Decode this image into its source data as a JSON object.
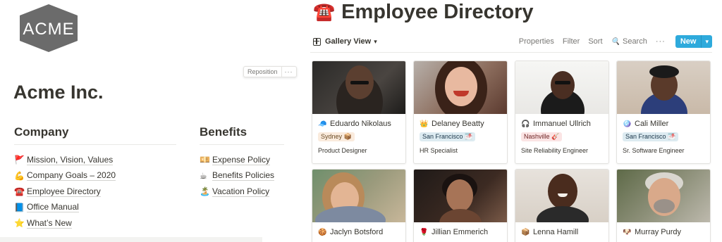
{
  "logo": {
    "text": "ACME",
    "bg_color": "#6b6b6b"
  },
  "company": {
    "title": "Acme Inc."
  },
  "sections": {
    "company": {
      "heading": "Company",
      "items": [
        {
          "icon": "🚩",
          "icon_name": "flag-icon",
          "label": "Mission, Vision, Values"
        },
        {
          "icon": "💪",
          "icon_name": "flexed-biceps-icon",
          "label": "Company Goals – 2020"
        },
        {
          "icon": "☎️",
          "icon_name": "telephone-icon",
          "label": "Employee Directory"
        },
        {
          "icon": "📘",
          "icon_name": "blue-book-icon",
          "label": "Office Manual"
        },
        {
          "icon": "⭐",
          "icon_name": "star-icon",
          "label": "What’s New"
        }
      ]
    },
    "benefits": {
      "heading": "Benefits",
      "items": [
        {
          "icon": "💴",
          "icon_name": "money-icon",
          "label": "Expense Policy"
        },
        {
          "icon": "☕",
          "icon_name": "coffee-icon",
          "label": "Benefits Policies"
        },
        {
          "icon": "🏝️",
          "icon_name": "desert-island-icon",
          "label": "Vacation Policy"
        }
      ]
    }
  },
  "page": {
    "icon": "☎️",
    "icon_name": "telephone-icon",
    "title": "Employee Directory"
  },
  "toolbar": {
    "view_label": "Gallery View",
    "properties": "Properties",
    "filter": "Filter",
    "sort": "Sort",
    "search": "Search",
    "more": "···",
    "new_label": "New",
    "new_chevron": "⌄",
    "accent_color": "#2eaadc"
  },
  "card_hover": {
    "reposition": "Reposition",
    "more": "···"
  },
  "cards": [
    {
      "icon": "🧢",
      "name": "Eduardo Nikolaus",
      "tag": "Sydney 📦",
      "role": "Product Designer"
    },
    {
      "icon": "👑",
      "name": "Delaney Beatty",
      "tag": "San Francisco 🌁",
      "role": "HR Specialist"
    },
    {
      "icon": "🎧",
      "name": "Immanuel Ullrich",
      "tag": "Nashville 🎸",
      "role": "Site Reliability Engineer"
    },
    {
      "icon": "🪩",
      "name": "Cali Miller",
      "tag": "San Francisco 🌁",
      "role": "Sr. Software Engineer"
    },
    {
      "icon": "🍪",
      "name": "Jaclyn Botsford"
    },
    {
      "icon": "🌹",
      "name": "Jillian Emmerich"
    },
    {
      "icon": "📦",
      "name": "Lenna Hamill"
    },
    {
      "icon": "🐶",
      "name": "Murray Purdy"
    }
  ]
}
